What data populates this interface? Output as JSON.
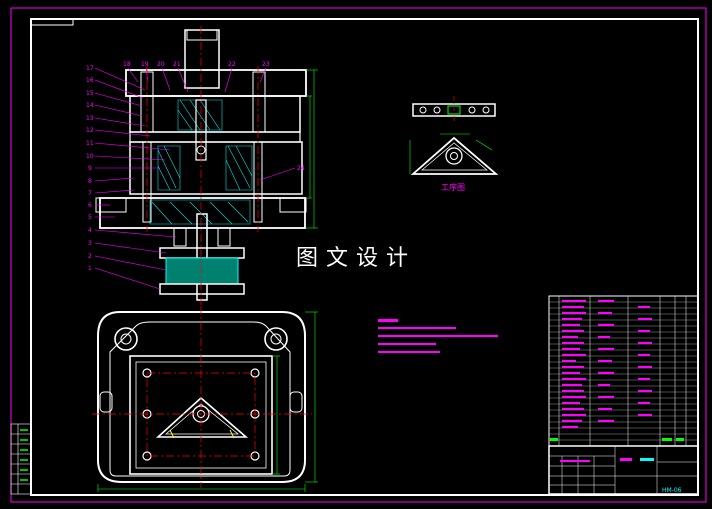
{
  "drawing": {
    "watermark": "图文设计",
    "process_label": "工序图",
    "part_labels": [
      "1",
      "2",
      "3",
      "4",
      "5",
      "6",
      "7",
      "8",
      "9",
      "10",
      "11",
      "12",
      "13",
      "14",
      "15",
      "16",
      "17",
      "18",
      "19",
      "20",
      "21",
      "22",
      "23",
      "24"
    ],
    "title_block_code": "HM-06",
    "colors": {
      "background": "#000000",
      "outline": "#ffffff",
      "dimension": "#00ff00",
      "leader": "#ff00ff",
      "centerline": "#ff0000",
      "hatch": "#00ffff",
      "accent": "#ffff00"
    }
  }
}
